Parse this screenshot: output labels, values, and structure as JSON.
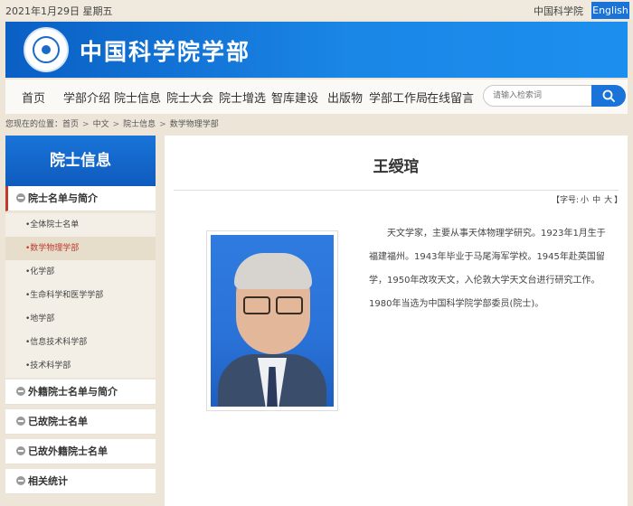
{
  "topbar": {
    "date": "2021年1月29日 星期五",
    "cas_link": "中国科学院",
    "english": "English"
  },
  "header": {
    "site_title": "中国科学院学部",
    "logo_icon": "cas-emblem-icon"
  },
  "nav": {
    "items": [
      "首页",
      "学部介绍",
      "院士信息",
      "院士大会",
      "院士增选",
      "智库建设",
      "出版物",
      "学部工作局",
      "在线留言"
    ],
    "search_placeholder": "请输入检索词",
    "search_icon": "search-icon"
  },
  "breadcrumb": {
    "prefix": "您现在的位置：",
    "items": [
      "首页",
      "中文",
      "院士信息",
      "数学物理学部"
    ],
    "sep": ">"
  },
  "sidebar": {
    "title": "院士信息",
    "sections": [
      {
        "label": "院士名单与简介"
      },
      {
        "label": "外籍院士名单与简介"
      },
      {
        "label": "已故院士名单"
      },
      {
        "label": "已故外籍院士名单"
      },
      {
        "label": "相关统计"
      }
    ],
    "subitems": [
      "•全体院士名单",
      "•数学物理学部",
      "•化学部",
      "•生命科学和医学学部",
      "•地学部",
      "•信息技术科学部",
      "•技术科学部"
    ]
  },
  "main": {
    "name": "王绶琯",
    "font_size": {
      "prefix": "【字号:",
      "small": "小",
      "medium": "中",
      "large": "大",
      "suffix": "】"
    },
    "bio": "天文学家，主要从事天体物理学研究。1923年1月生于福建福州。1943年毕业于马尾海军学校。1945年赴英国留学，1950年改攻天文，入伦敦大学天文台进行研究工作。1980年当选为中国科学院学部委员(院士)。"
  },
  "colors": {
    "accent": "#1a73d9",
    "active_red": "#c0392b"
  }
}
